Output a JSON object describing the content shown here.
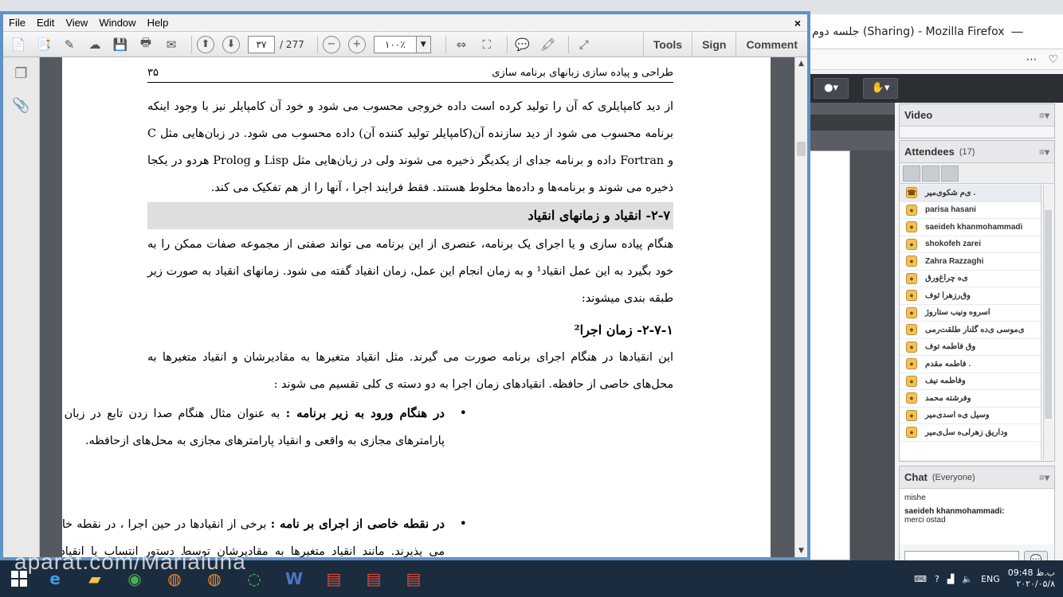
{
  "firefox": {
    "title": "جلسه دوم (Sharing) - Mozilla Firefox",
    "minimize_glyph": "—",
    "url_icons": [
      "⋯",
      "♡"
    ]
  },
  "adobe_connect": {
    "video_pod": {
      "title": "Video",
      "menu": "≡▾"
    },
    "attendees_pod": {
      "title": "Attendees",
      "count": "(17)",
      "menu": "≡▾",
      "rows": [
        {
          "name": "ی‌م شکوی‌میر .",
          "icon": "phone-icon",
          "host": true
        },
        {
          "name": "parisa hasani",
          "icon": "user-icon"
        },
        {
          "name": "saeideh khanmohammadi",
          "icon": "user-icon"
        },
        {
          "name": "shokofeh zarei",
          "icon": "user-icon"
        },
        {
          "name": "Zahra Razzaghi",
          "icon": "user-icon"
        },
        {
          "name": "ی‌ه چراغ‌ورق",
          "icon": "user-icon"
        },
        {
          "name": "وق‌رزهرا ثوف",
          "icon": "user-icon"
        },
        {
          "name": "اسرو‌ه ونیب ستاروژ",
          "icon": "user-icon"
        },
        {
          "name": "ی‌موسی ی‌ده گلنار طلقت‌رمی",
          "icon": "user-icon"
        },
        {
          "name": "وق فاطمه توف",
          "icon": "user-icon"
        },
        {
          "name": "فاطمه مقدم .",
          "icon": "user-icon"
        },
        {
          "name": "وفاطمه نیف",
          "icon": "user-icon"
        },
        {
          "name": "وفرشته محمد",
          "icon": "user-icon"
        },
        {
          "name": "وسیل ی‌ه اسدی‌میر",
          "icon": "user-icon"
        },
        {
          "name": "وداریق زهرلی‌ه سل‌ی‌میر",
          "icon": "user-icon"
        }
      ]
    },
    "chat_pod": {
      "title": "Chat",
      "scope": "(Everyone)",
      "menu": "≡▾",
      "messages": [
        {
          "author": "",
          "text": "mishe"
        },
        {
          "author": "saeideh khanmohammadi:",
          "text": "merci ostad"
        }
      ],
      "send_icon": "speech-bubble-icon"
    }
  },
  "acrobat": {
    "menu": [
      "File",
      "Edit",
      "View",
      "Window",
      "Help"
    ],
    "close_glyph": "×",
    "page_current": "۳۷",
    "page_total": "/ 277",
    "zoom": "۱۰۰٪",
    "zoom_dropdown": "▼",
    "right_tools": [
      "Tools",
      "Sign",
      "Comment"
    ],
    "scroll_up": "▲",
    "scroll_down": "▼",
    "page": {
      "header_title": "طراحی و پیاده سازی زبانهای برنامه سازی",
      "header_page": "۳۵",
      "para1": "از دید کامپایلری که آن را تولید کرده است داده خروجی محسوب می شود و خود آن کامپایلر نیز با وجود اینکه برنامه محسوب می شود از دید سازنده آن(کامپایلر تولید کننده آن) داده محسوب می شود. در زبان‌هایی مثل C و Fortran داده و برنامه جدای از یکدیگر ذخیره می شوند ولی در زبان‌هایی مثل Lisp و Prolog هردو در یکجا ذخیره می شوند و برنامه‌ها و داده‌ها مخلوط هستند. فقط فرایند اجرا ، آنها را از هم تفکیک می کند.",
      "heading": "۲-۷- انقیاد و زمانهای انقیاد",
      "para2": "هنگام پیاده سازی و یا اجرای یک برنامه، عنصری از این برنامه می تواند صفتی از مجموعه صفات ممکن را به خود بگیرد به این عمل انقیاد¹ و به زمان انجام این عمل، زمان انقیاد گفته می شود. زمانهای انقیاد به صورت زیر طبقه بندی میشوند:",
      "subheading": "۲-۷-۱- زمان اجرا²",
      "para3": "این انقیادها در هنگام اجرای برنامه صورت می گیرند. مثل انقیاد متغیرها به مقادیرشان و انقیاد متغیرها به محل‌های خاصی از حافظه. انقیادهای زمان اجرا به دو دسته ی کلی تقسیم می شوند :",
      "bullet1_bold": "در هنگام ورود به زیر برنامه :",
      "bullet1_text": " به عنوان مثال هنگام صدا زدن تابع در زبان C یا Pascal انقیاد پارامترهای مجازی به واقعی و انقیاد پارامترهای مجازی به محل‌های ازحافظه.",
      "bullet2_bold": "در نقطه خاصی از اجرای بر نامه :",
      "bullet2_text": " برخی از انقیادها در حین اجرا ، در نقطه خاصی از بر نامه انجام می پذیرند. مانند انقیاد متغیرها به مقادیرشان توسط دستور انتساب یا انقیاد اسامی متغیرها به محل‌هایی از حافظه در هر نقطه ای از برنامه مثلاً در زبان ML و Lisp.",
      "bullet_glyph": "•"
    }
  },
  "taskbar": {
    "apps": [
      "start-icon",
      "edge-icon",
      "file-explorer-icon",
      "chrome-icon",
      "firefox-icon",
      "firefox-icon",
      "whatsapp-icon",
      "word-icon",
      "pdf-icon",
      "pdf-icon",
      "pdf-icon"
    ],
    "lang": "ENG",
    "time": "09:48 ب.ظ",
    "date": "۲۰۲۰/۰۵/۸"
  },
  "watermark": "aparat.com/Marialuna",
  "colors": {
    "acrobat_frame": "#5f93c7",
    "taskbar": "#1a2c3e",
    "heading_bar": "#dedede",
    "adobe_connect_dark": "#2b2e33"
  }
}
